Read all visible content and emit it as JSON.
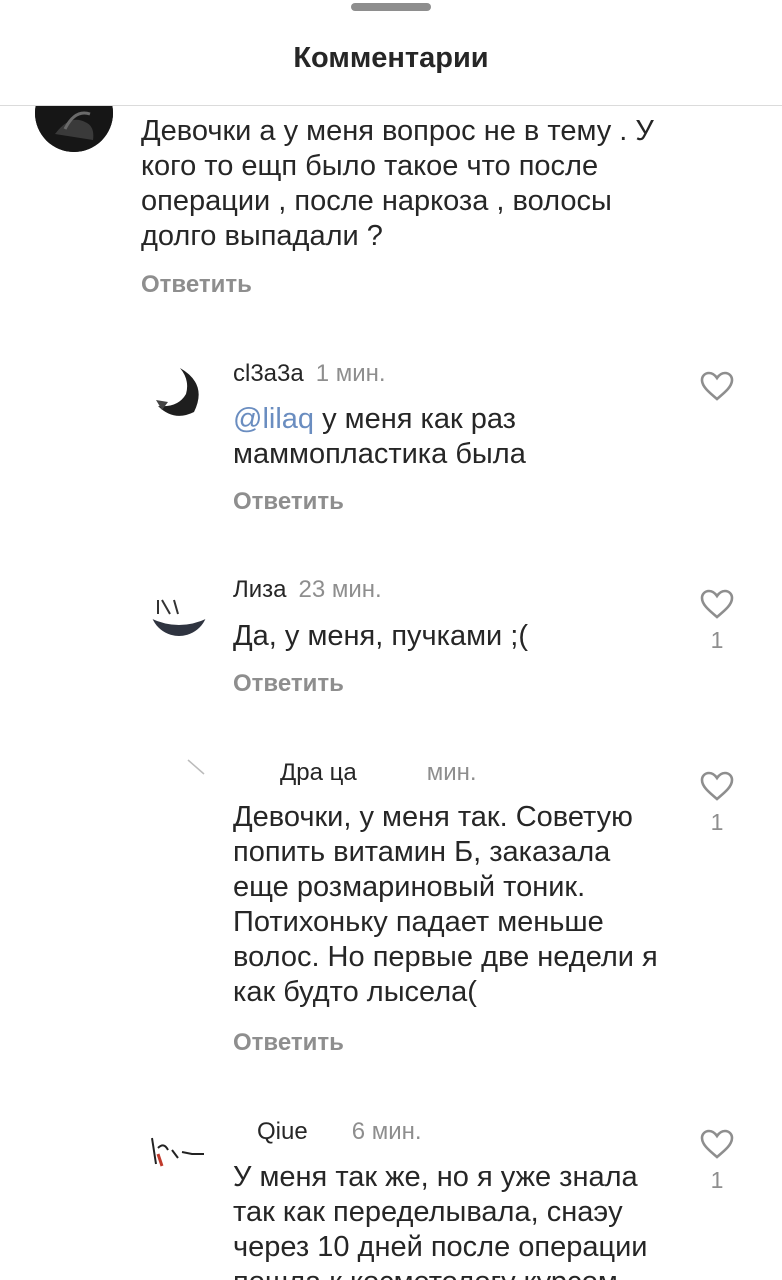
{
  "header": {
    "title": "Комментарии"
  },
  "comments": [
    {
      "text": "Девочки а у меня вопрос не в тему . У кого то ещп было такое что после операции , после наркоза , волосы долго выпадали ?",
      "reply_label": "Ответить"
    },
    {
      "username": "cl3a3a",
      "time": "1 мин.",
      "mention": "@lilaq",
      "text": "у меня как раз маммопластика была",
      "reply_label": "Ответить"
    },
    {
      "username": "Лиза",
      "time": "23 мин.",
      "text": "Да, у меня, пучками ;(",
      "reply_label": "Ответить",
      "likes": "1"
    },
    {
      "username": "Дра  ца",
      "time": "мин.",
      "text": "Девочки, у меня так. Советую попить витамин Б, заказала еще розмариновый тоник. Потихоньку падает меньше волос. Но первые две недели я как будто лысела(",
      "reply_label": "Ответить",
      "likes": "1"
    },
    {
      "username": "Qiue",
      "time": "6 мин.",
      "text": "У меня так же, но я уже знала так как переделывала, снаэу через 10 дней после операции пошла к косметологу курсом",
      "likes": "1"
    }
  ],
  "colors": {
    "text": "#262626",
    "secondary": "#8e8e8e",
    "divider": "#dbdbdb",
    "mention": "#6a8dc0"
  }
}
